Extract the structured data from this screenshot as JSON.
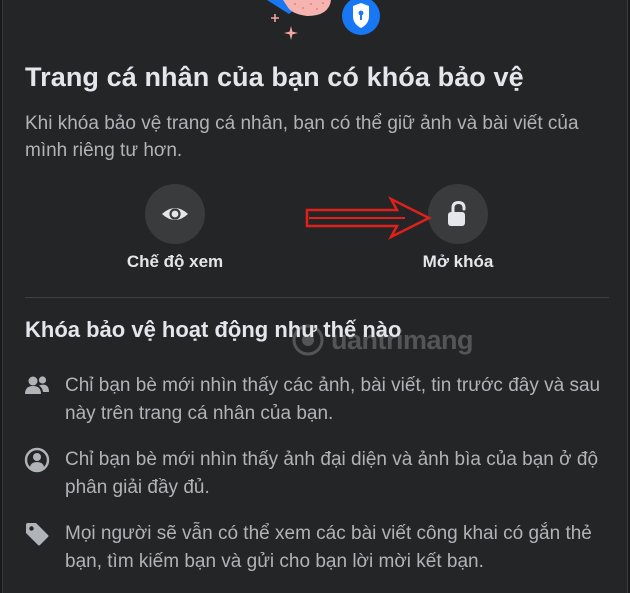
{
  "dialog": {
    "title": "Trang cá nhân của bạn có khóa bảo vệ",
    "subtitle": "Khi khóa bảo vệ trang cá nhân, bạn có thể giữ ảnh và bài viết của mình riêng tư hơn."
  },
  "actions": [
    {
      "label": "Chế độ xem",
      "icon": "eye-icon"
    },
    {
      "label": "Mở khóa",
      "icon": "unlock-icon"
    }
  ],
  "section": {
    "heading": "Khóa bảo vệ hoạt động như thế nào"
  },
  "features": [
    {
      "icon": "friends-icon",
      "text": "Chỉ bạn bè mới nhìn thấy các ảnh, bài viết, tin trước đây và sau này trên trang cá nhân của bạn."
    },
    {
      "icon": "profile-icon",
      "text": "Chỉ bạn bè mới nhìn thấy ảnh đại diện và ảnh bìa của bạn ở độ phân giải đầy đủ."
    },
    {
      "icon": "tag-icon",
      "text": "Mọi người sẽ vẫn có thể xem các bài viết công khai có gắn thẻ bạn, tìm kiếm bạn và gửi cho bạn lời mời kết bạn."
    }
  ],
  "watermark": "uantrimang",
  "colors": {
    "panel_bg": "#242526",
    "text_primary": "#e4e6eb",
    "text_secondary": "#b0b3b8",
    "button_bg": "#3a3b3c",
    "accent_blue": "#1877f2",
    "arrow_red": "#e0201b"
  }
}
